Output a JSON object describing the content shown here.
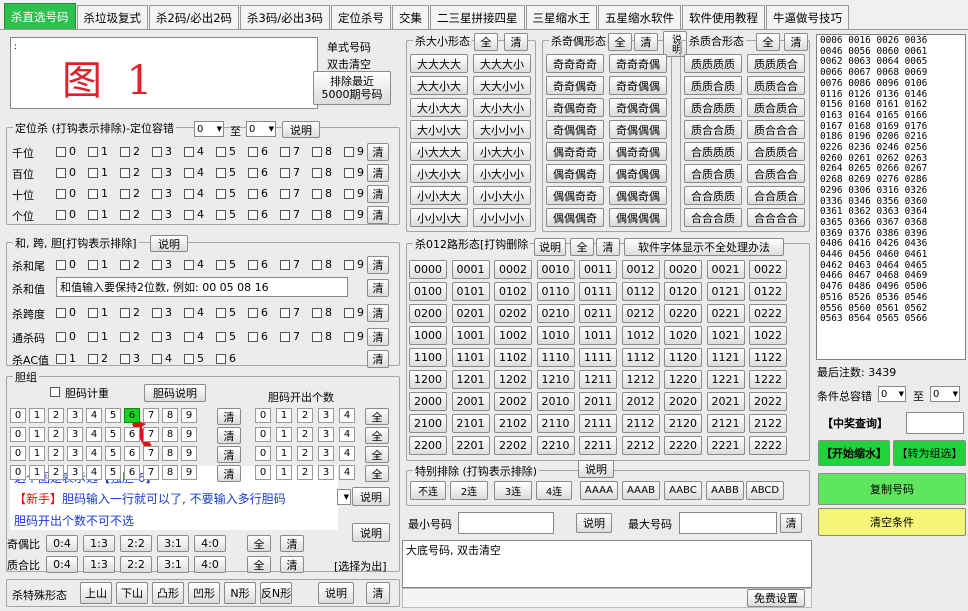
{
  "tabs": [
    "杀直选号码",
    "杀垃圾复式",
    "杀2码/必出2码",
    "杀3码/必出3码",
    "定位杀号",
    "交集",
    "二三星拼接四星",
    "三星缩水王",
    "五星缩水软件",
    "软件使用教程",
    "牛逼做号技巧"
  ],
  "top": {
    "big_label": "图 1",
    "single_label": "单式号码",
    "dblclick_label": "双击清空",
    "recent_btn": "排除最近\n5000期号码",
    "colon": ":"
  },
  "position_kill": {
    "title": "定位杀 (打钩表示排除)-定位容错",
    "to": "至",
    "sel_from": "0",
    "sel_to": "0",
    "explain": "说明",
    "rows": [
      "千位",
      "百位",
      "十位",
      "个位"
    ],
    "clear": "清",
    "digits": [
      "0",
      "1",
      "2",
      "3",
      "4",
      "5",
      "6",
      "7",
      "8",
      "9"
    ]
  },
  "sum_span": {
    "title": "和, 跨, 胆[打钩表示排除]",
    "explain": "说明",
    "kill_tail": "杀和尾",
    "kill_sum": "杀和值",
    "sum_hint": "和值输入要保持2位数, 例如: 00 05 08 16",
    "kill_span": "杀跨度",
    "kill_tong": "通杀码",
    "kill_ac": "杀AC值",
    "clear": "清",
    "ac_digits": [
      "1",
      "2",
      "3",
      "4",
      "5",
      "6"
    ]
  },
  "dan": {
    "title": "胆组",
    "count_label": "胆码计重",
    "explain": "胆码说明",
    "out_label": "胆码开出个数",
    "digits": [
      "0",
      "1",
      "2",
      "3",
      "4",
      "5",
      "6",
      "7",
      "8",
      "9"
    ],
    "out_digits": [
      "0",
      "1",
      "2",
      "3",
      "4"
    ],
    "clear": "清",
    "all": "全",
    "hot_digit": "6",
    "note1a": "这个图是表示选【独胆 6】",
    "note2a": "【新手】",
    "note2b": "胆码输入一行就可以了, 不要输入多行胆码",
    "note3": "胆码开出个数不可不选"
  },
  "ratio": {
    "odd_label": "奇偶比",
    "prime_label": "质合比",
    "values": [
      "0:4",
      "1:3",
      "2:2",
      "3:1",
      "4:0"
    ],
    "all": "全",
    "clear": "清",
    "explain": "说明",
    "choose": "[选择为出]"
  },
  "special_shape": {
    "title": "杀特殊形态",
    "items": [
      "上山",
      "下山",
      "凸形",
      "凹形",
      "N形",
      "反N形"
    ],
    "explain": "说明",
    "clear": "清"
  },
  "big_small": {
    "title": "杀大小形态",
    "all": "全",
    "clear": "清",
    "items": [
      "大大大大",
      "大大大小",
      "大大小大",
      "大大小小",
      "大小大大",
      "大小大小",
      "大小小大",
      "大小小小",
      "小大大大",
      "小大大小",
      "小大小大",
      "小大小小",
      "小小大大",
      "小小大小",
      "小小小大",
      "小小小小"
    ]
  },
  "odd_even": {
    "title": "杀奇偶形态",
    "all": "全",
    "clear": "清",
    "explain": "说明",
    "items": [
      "奇奇奇奇",
      "奇奇奇偶",
      "奇奇偶奇",
      "奇奇偶偶",
      "奇偶奇奇",
      "奇偶奇偶",
      "奇偶偶奇",
      "奇偶偶偶",
      "偶奇奇奇",
      "偶奇奇偶",
      "偶奇偶奇",
      "偶奇偶偶",
      "偶偶奇奇",
      "偶偶奇偶",
      "偶偶偶奇",
      "偶偶偶偶"
    ]
  },
  "prime": {
    "title": "杀质合形态",
    "all": "全",
    "clear": "清",
    "items": [
      "质质质质",
      "质质质合",
      "质质合质",
      "质质合合",
      "质合质质",
      "质合质合",
      "质合合质",
      "质合合合",
      "合质质质",
      "合质质合",
      "合质合质",
      "合质合合",
      "合合质质",
      "合合质合",
      "合合合质",
      "合合合合"
    ]
  },
  "route012": {
    "title": "杀012路形态[打钩删除",
    "explain": "说明",
    "all": "全",
    "clear": "清",
    "font_btn": "软件字体显示不全处理办法",
    "items": [
      "0000",
      "0001",
      "0002",
      "0010",
      "0011",
      "0012",
      "0020",
      "0021",
      "0022",
      "0100",
      "0101",
      "0102",
      "0110",
      "0111",
      "0112",
      "0120",
      "0121",
      "0122",
      "0200",
      "0201",
      "0202",
      "0210",
      "0211",
      "0212",
      "0220",
      "0221",
      "0222",
      "1000",
      "1001",
      "1002",
      "1010",
      "1011",
      "1012",
      "1020",
      "1021",
      "1022",
      "1100",
      "1101",
      "1102",
      "1110",
      "1111",
      "1112",
      "1120",
      "1121",
      "1122",
      "1200",
      "1201",
      "1202",
      "1210",
      "1211",
      "1212",
      "1220",
      "1221",
      "1222",
      "2000",
      "2001",
      "2002",
      "2010",
      "2011",
      "2012",
      "2020",
      "2021",
      "2022",
      "2100",
      "2101",
      "2102",
      "2110",
      "2111",
      "2112",
      "2120",
      "2121",
      "2122",
      "2200",
      "2201",
      "2202",
      "2210",
      "2211",
      "2212",
      "2220",
      "2221",
      "2222"
    ]
  },
  "special_exclude": {
    "title": "特别排除 (打钩表示排除)",
    "explain": "说明",
    "items": [
      "不连",
      "2连",
      "3连",
      "4连",
      "AAAA",
      "AAAB",
      "AABC",
      "AABB",
      "ABCD"
    ]
  },
  "minmax": {
    "min_label": "最小号码",
    "max_label": "最大号码",
    "explain": "说明",
    "clear": "清"
  },
  "big_base": {
    "text": "大底号码, 双击清空",
    "free": "免费设置"
  },
  "right": {
    "numbers": "0006 0016 0026 0036\n0046 0056 0060 0061\n0062 0063 0064 0065\n0066 0067 0068 0069\n0076 0086 0096 0106\n0116 0126 0136 0146\n0156 0160 0161 0162\n0163 0164 0165 0166\n0167 0168 0169 0176\n0186 0196 0206 0216\n0226 0236 0246 0256\n0260 0261 0262 0263\n0264 0265 0266 0267\n0268 0269 0276 0286\n0296 0306 0316 0326\n0336 0346 0356 0360\n0361 0362 0363 0364\n0365 0366 0367 0368\n0369 0376 0386 0396\n0406 0416 0426 0436\n0446 0456 0460 0461\n0462 0463 0464 0465\n0466 0467 0468 0469\n0476 0486 0496 0506\n0516 0526 0536 0546\n0556 0560 0561 0562\n0563 0564 0565 0566",
    "final_label": "最后注数:",
    "final_count": "3439",
    "tol_label": "条件总容错",
    "tol_from": "0",
    "to": "至",
    "tol_to": "0",
    "prize": "【中奖查询】",
    "start": "【开始缩水】",
    "convert": "【转为组选】",
    "copy": "复制号码",
    "clear_cond": "清空条件"
  },
  "colors": {
    "tab_active": "#2fbf4f",
    "big_label": "#e0202a",
    "hot": "#16d320",
    "note_blue": "#1a3bd6",
    "note_red": "#e01010",
    "start_bg": "#22d23a",
    "copy_bg": "#5ee65e",
    "clear_bg": "#f6f676"
  }
}
